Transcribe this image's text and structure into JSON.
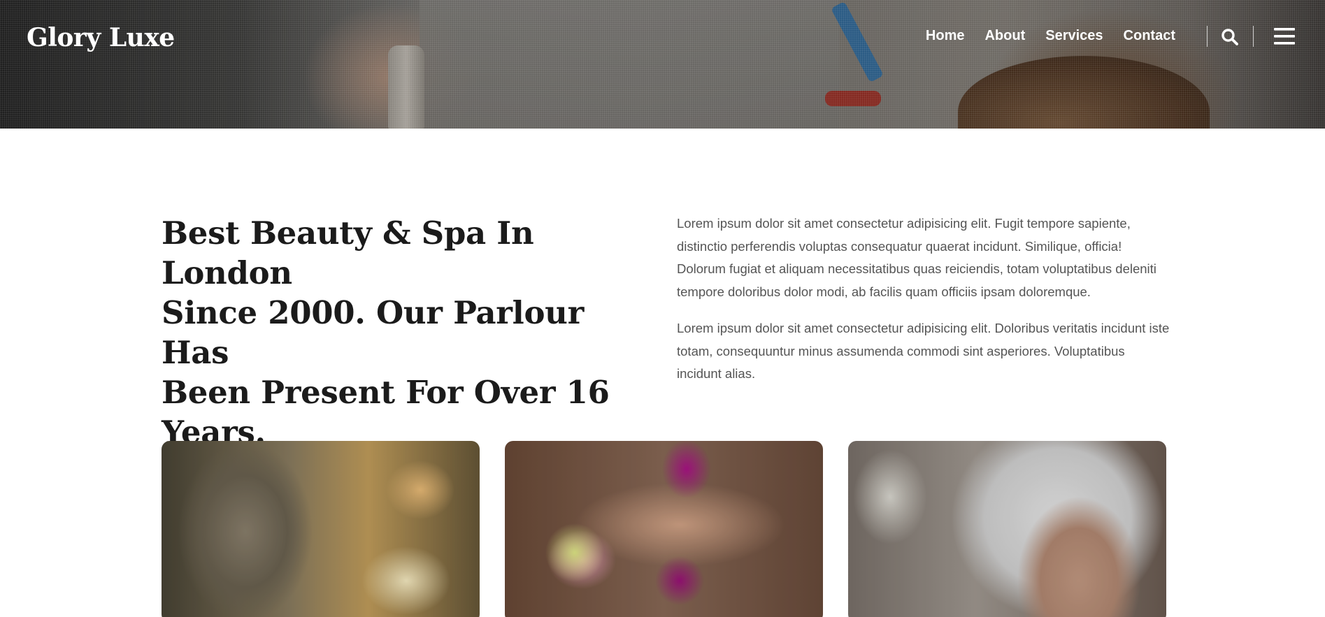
{
  "header": {
    "brand": "Glory Luxe",
    "nav": [
      {
        "label": "Home"
      },
      {
        "label": "About"
      },
      {
        "label": "Services"
      },
      {
        "label": "Contact"
      }
    ],
    "search_icon": "search-icon",
    "menu_icon": "hamburger-menu-icon"
  },
  "intro": {
    "headline_lines": [
      "Best Beauty & Spa In London",
      "Since 2000. Our Parlour Has",
      "Been Present For Over 16 Years."
    ],
    "paragraphs": [
      "Lorem ipsum dolor sit amet consectetur adipisicing elit. Fugit tempore sapiente, distinctio perferendis voluptas consequatur quaerat incidunt. Similique, officia! Dolorum fugiat et aliquam necessitatibus quas reiciendis, totam voluptatibus deleniti tempore doloribus dolor modi, ab facilis quam officiis ipsam doloremque.",
      "Lorem ipsum dolor sit amet consectetur adipisicing elit. Doloribus veritatis incidunt iste totam, consequuntur minus assumenda commodi sint asperiores. Voluptatibus incidunt alias."
    ]
  },
  "colors": {
    "heading": "#1b1b1b",
    "body_text": "#555555",
    "nav_text": "#ffffff"
  }
}
